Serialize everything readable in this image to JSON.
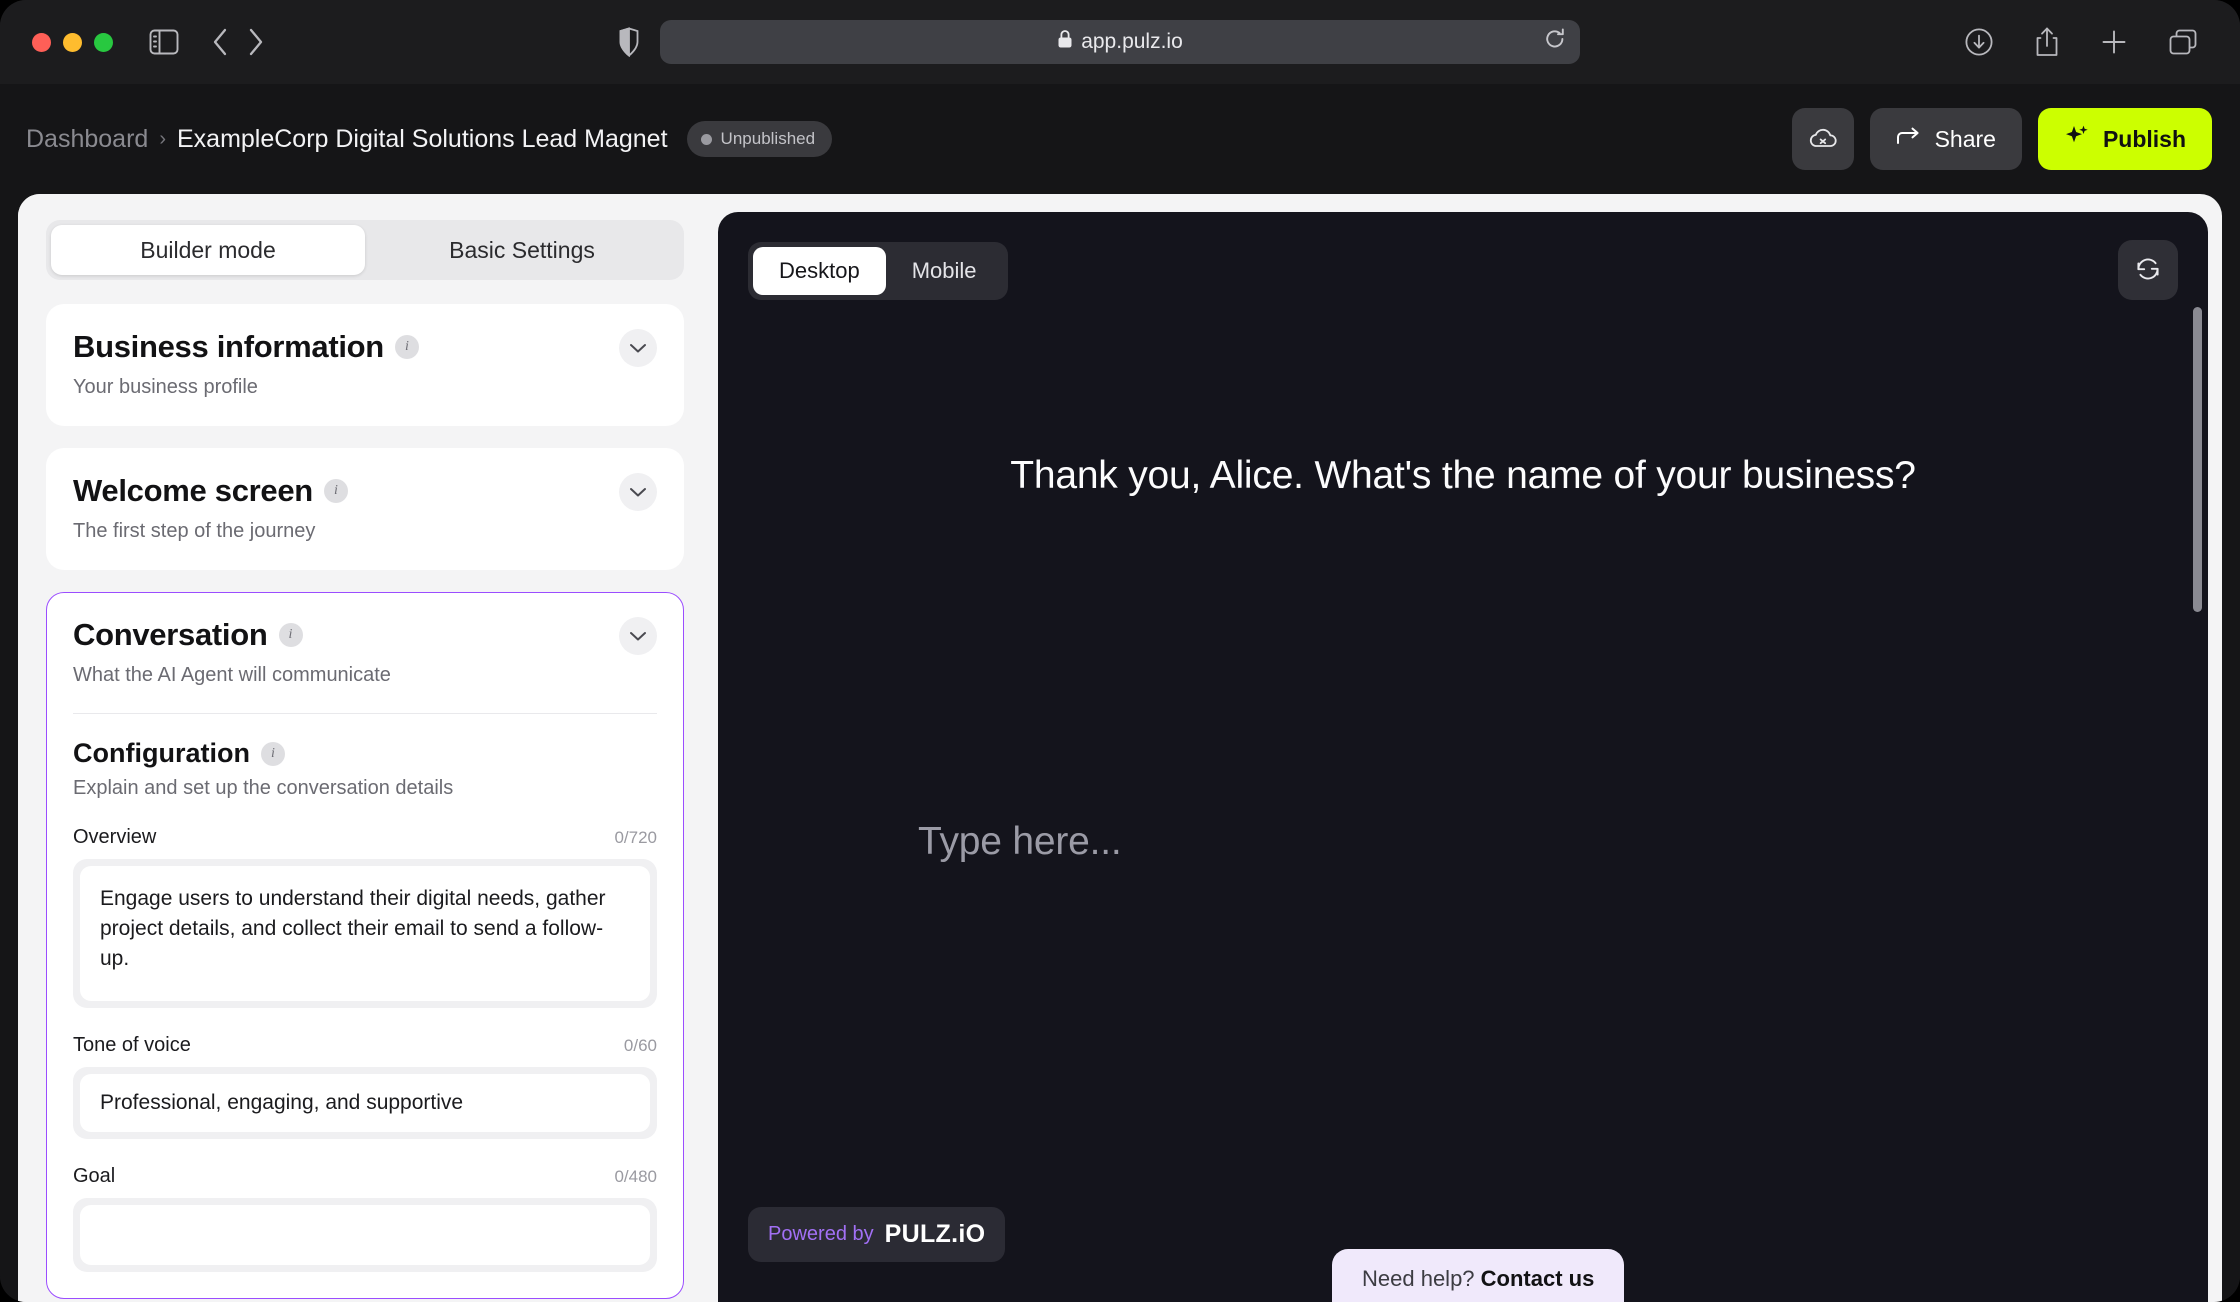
{
  "browser": {
    "url": "app.pulz.io",
    "lock_icon": "lock-icon",
    "reload_icon": "reload-icon",
    "sidebar_icon": "sidebar-toggle-icon",
    "back_icon": "back-chevron-icon",
    "forward_icon": "forward-chevron-icon",
    "shield_icon": "shield-privacy-icon",
    "downloads_icon": "downloads-icon",
    "share_icon": "share-icon",
    "new_tab_icon": "plus-icon",
    "tabs_icon": "tab-overview-icon"
  },
  "header": {
    "breadcrumb_root": "Dashboard",
    "breadcrumb_separator": "›",
    "breadcrumb_current": "ExampleCorp Digital Solutions Lead Magnet",
    "status_badge": "Unpublished",
    "cloud_button_icon": "cloud-off-icon",
    "share_label": "Share",
    "share_icon": "arrow-share-icon",
    "publish_label": "Publish",
    "publish_icon": "sparkle-icon",
    "publish_color": "#ccff00"
  },
  "builder": {
    "tabs": [
      {
        "label": "Builder mode",
        "active": true
      },
      {
        "label": "Basic Settings",
        "active": false
      }
    ],
    "cards": [
      {
        "title": "Business information",
        "subtitle": "Your business profile",
        "active": false
      },
      {
        "title": "Welcome screen",
        "subtitle": "The first step of the journey",
        "active": false
      },
      {
        "title": "Conversation",
        "subtitle": "What the AI Agent will communicate",
        "active": true
      }
    ],
    "configuration": {
      "title": "Configuration",
      "subtitle": "Explain and set up the conversation details",
      "fields": [
        {
          "label": "Overview",
          "counter": "0/720",
          "value": "Engage users to understand their digital needs, gather project details, and collect their email to send a follow-up."
        },
        {
          "label": "Tone of voice",
          "counter": "0/60",
          "value": "Professional, engaging, and supportive"
        },
        {
          "label": "Goal",
          "counter": "0/480",
          "value": ""
        }
      ]
    },
    "accent_border_color": "#9b4dff"
  },
  "preview": {
    "device_tabs": [
      {
        "label": "Desktop",
        "active": true
      },
      {
        "label": "Mobile",
        "active": false
      }
    ],
    "restart_icon": "refresh-circle-icon",
    "question": "Thank you, Alice. What's the name of your business?",
    "input_placeholder": "Type here...",
    "powered_by_prefix": "Powered by",
    "powered_by_brand": "PULZ.iO",
    "powered_by_prefix_color": "#a270f5"
  },
  "footer": {
    "help_prefix": "Need help? ",
    "help_link": "Contact us"
  }
}
